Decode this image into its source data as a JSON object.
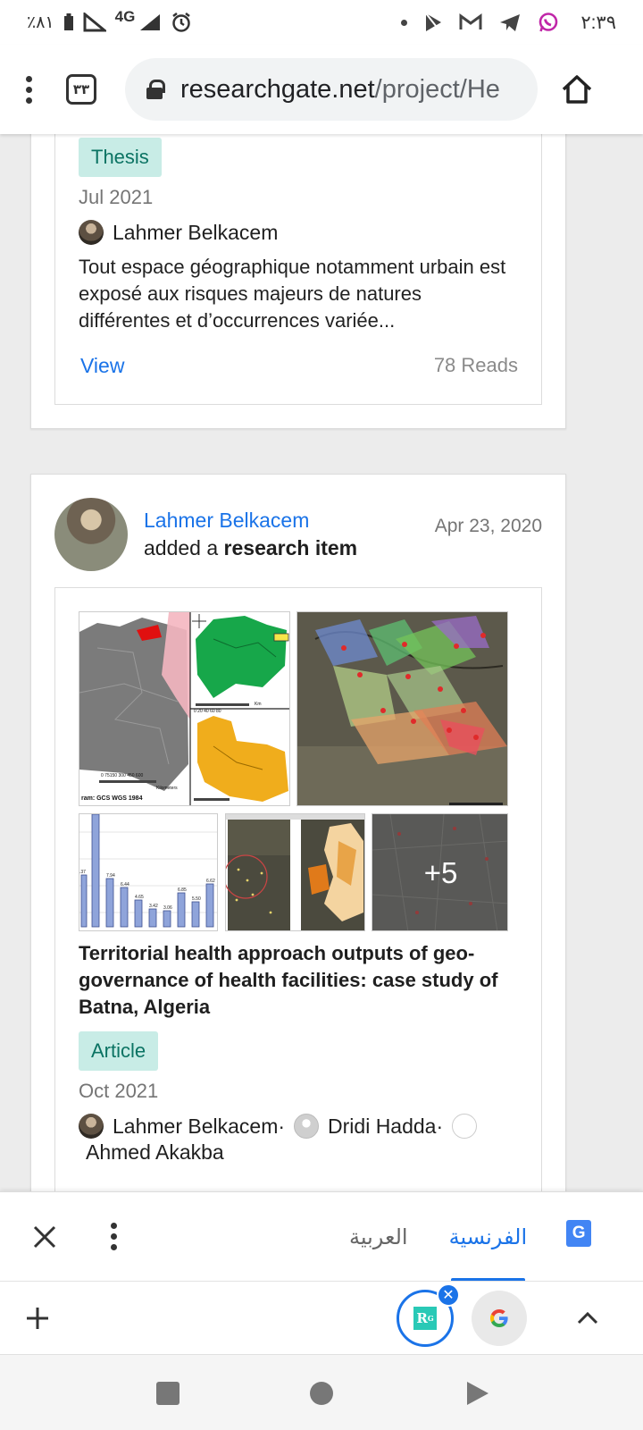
{
  "status_bar": {
    "battery": "٪٨١",
    "network": "4G",
    "time": "٢:٣٩"
  },
  "browser": {
    "tab_count": "٣٣",
    "url_domain": "researchgate.net",
    "url_path": "/project/He"
  },
  "item1": {
    "type": "Thesis",
    "date": "Jul 2021",
    "author": "Lahmer Belkacem",
    "abstract": "Tout espace géographique notamment urbain est exposé aux risques majeurs de natures différentes et d’occurrences variée...",
    "view_label": "View",
    "reads": "78 Reads"
  },
  "item2": {
    "actor": "Lahmer Belkacem",
    "action_prefix": "added a ",
    "action_bold": "research item",
    "posted_date": "Apr 23, 2020",
    "more_images": "+5",
    "map_caption": "ram: GCS WGS 1984",
    "map_scale_labels": [
      "0  75150  300  450  600",
      "Kilometers"
    ],
    "inset_scale_label": "0  20 40  60  80",
    "inset_unit": "Km",
    "bar_labels": [
      "7.94",
      "6.44",
      "4.65",
      "3.42",
      "3.06",
      "6.85",
      "5.50",
      "6.62",
      ".37"
    ],
    "title": "Territorial health approach outputs of geo-governance of health facilities: case study of Batna, Algeria",
    "type": "Article",
    "date": "Oct 2021",
    "authors": [
      {
        "name": "Lahmer Belkacem",
        "sep": " ·"
      },
      {
        "name": "Dridi Hadda",
        "sep": " ·"
      },
      {
        "name": "Ahmed Akakba",
        "sep": ""
      }
    ]
  },
  "translate_bar": {
    "lang_target": "العربية",
    "lang_source": "الفرنسية"
  },
  "colors": {
    "link": "#1a73e8",
    "tag_bg": "#c8ece6",
    "tag_text": "#0b7363",
    "whatsapp": "#c026a8"
  },
  "icons": [
    "close-icon",
    "more-vert-icon",
    "google-translate-icon",
    "plus-icon",
    "researchgate-icon",
    "google-icon",
    "chevron-up-icon",
    "home-icon",
    "lock-icon"
  ]
}
